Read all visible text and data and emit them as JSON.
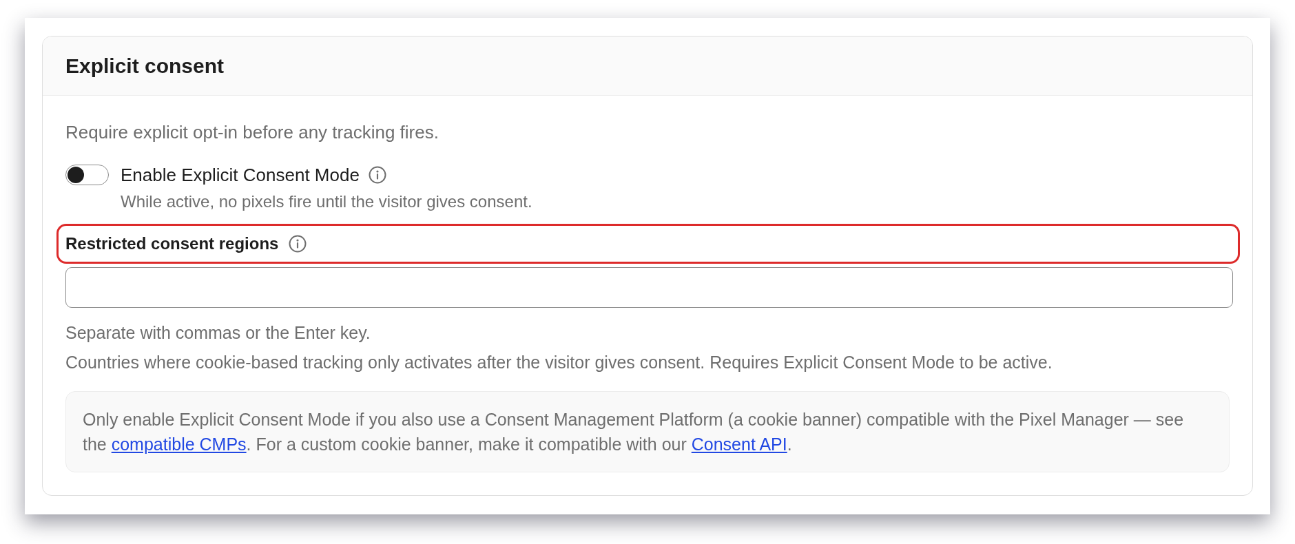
{
  "card": {
    "title": "Explicit consent",
    "description": "Require explicit opt-in before any tracking fires."
  },
  "toggle": {
    "label": "Enable Explicit Consent Mode",
    "on": false,
    "hint": "While active, no pixels fire until the visitor gives consent."
  },
  "regions_field": {
    "label": "Restricted consent regions",
    "highlighted": true,
    "help": [
      "Separate with commas or the Enter key.",
      "Countries where cookie-based tracking only activates after the visitor gives consent. Requires Explicit Consent Mode to be active."
    ]
  },
  "notice": {
    "parts": [
      {
        "kind": "text",
        "text": "Only enable Explicit Consent Mode if you also use a Consent Management Platform (a cookie banner) compatible with the Pixel Manager — see the "
      },
      {
        "kind": "link",
        "text": "compatible CMPs"
      },
      {
        "kind": "text",
        "text": ". For a custom cookie banner, make it compatible with our "
      },
      {
        "kind": "link",
        "text": "Consent API"
      },
      {
        "kind": "text",
        "text": "."
      }
    ]
  }
}
